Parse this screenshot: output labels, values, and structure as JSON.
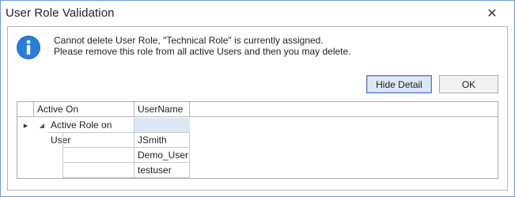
{
  "window": {
    "title": "User Role Validation",
    "close_glyph": "✕"
  },
  "message": {
    "icon": "info-icon",
    "icon_color": "#1f6fc5",
    "line1": "Cannot delete User Role, \"Technical Role\" is currently assigned.",
    "line2": "Please remove this role from all active Users and then you may delete."
  },
  "buttons": {
    "hide_detail": "Hide Detail",
    "ok": "OK"
  },
  "grid": {
    "columns": [
      "Active On",
      "UserName"
    ],
    "indicator_glyph": "▶",
    "expand_glyph": "◢",
    "group_row": {
      "label": "Active Role on User",
      "username": ""
    },
    "rows": [
      {
        "username": "JSmith"
      },
      {
        "username": "Demo_User"
      },
      {
        "username": "testuser"
      }
    ]
  },
  "colors": {
    "accent": "#4f7fc2",
    "selection": "#dbe7f5",
    "window_border": "#6f9bd1"
  }
}
